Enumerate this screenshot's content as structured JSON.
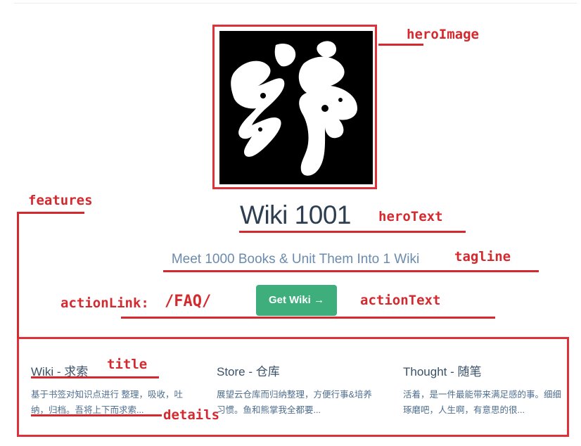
{
  "hero": {
    "hero_text": "Wiki 1001",
    "tagline": "Meet 1000 Books & Unit Them Into 1 Wiki",
    "action_text": "Get Wiki →"
  },
  "features": [
    {
      "title": "Wiki - 求索",
      "details": "基于书签对知识点进行 整理，吸收，吐纳，归档。吾将上下而求索..."
    },
    {
      "title": "Store - 仓库",
      "details": "展望云仓库而归纳整理，方便行事&培养习惯。鱼和熊掌我全都要..."
    },
    {
      "title": "Thought - 随笔",
      "details": "活着，是一件最能带来满足感的事。细细琢磨吧，人生啊，有意思的很..."
    }
  ],
  "annotations": {
    "hero_image": "heroImage",
    "features": "features",
    "hero_text": "heroText",
    "tagline": "tagline",
    "action_link": "actionLink:",
    "action_link_value": "/FAQ/",
    "action_text": "actionText",
    "title": "title",
    "details": "details"
  },
  "colors": {
    "accent": "#3eaf7c",
    "annotation": "#d42a2f",
    "title_text": "#2c3e50",
    "tagline_text": "#6a8bad"
  }
}
